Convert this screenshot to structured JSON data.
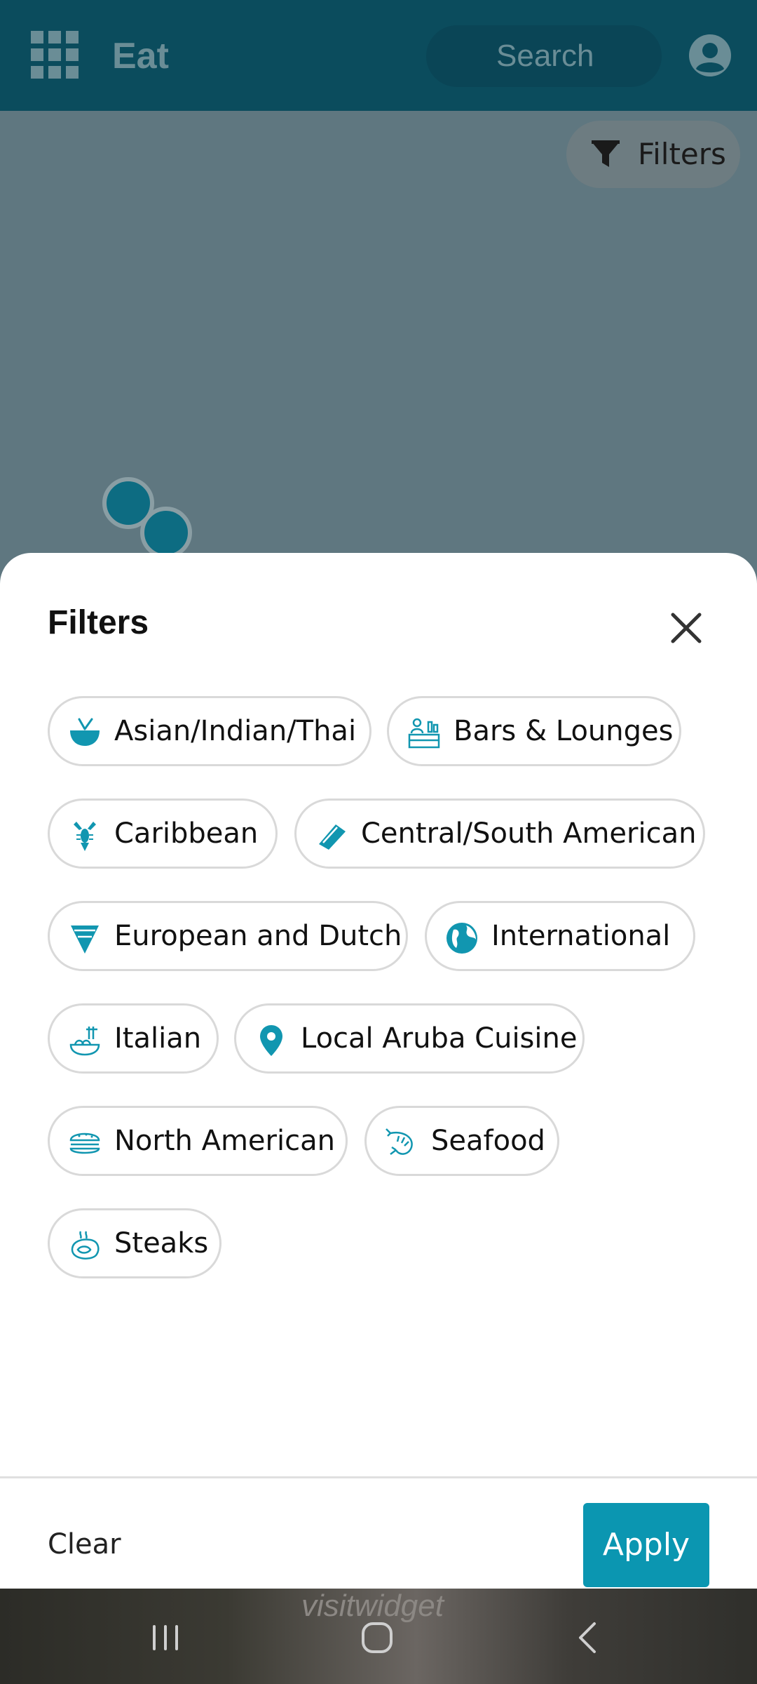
{
  "app": {
    "title": "Eat"
  },
  "search": {
    "placeholder": "Search"
  },
  "map": {
    "filters_button_label": "Filters"
  },
  "sheet": {
    "title": "Filters",
    "chips": [
      {
        "label": "Asian/Indian/Thai",
        "icon": "bowl-icon"
      },
      {
        "label": "Bars & Lounges",
        "icon": "bar-counter-icon"
      },
      {
        "label": "Caribbean",
        "icon": "lobster-icon"
      },
      {
        "label": "Central/South American",
        "icon": "burrito-icon"
      },
      {
        "label": "European and Dutch",
        "icon": "pizza-slice-icon"
      },
      {
        "label": "International",
        "icon": "globe-icon"
      },
      {
        "label": "Italian",
        "icon": "pasta-icon"
      },
      {
        "label": "Local Aruba Cuisine",
        "icon": "location-pin-icon"
      },
      {
        "label": "North American",
        "icon": "burger-icon"
      },
      {
        "label": "Seafood",
        "icon": "shrimp-icon"
      },
      {
        "label": "Steaks",
        "icon": "steak-icon"
      }
    ],
    "clear_label": "Clear",
    "apply_label": "Apply"
  },
  "background_watermark": "visitwidget",
  "colors": {
    "appbar": "#0b4c5d",
    "accent": "#0b96b1",
    "icon_teal": "#1196b0"
  }
}
